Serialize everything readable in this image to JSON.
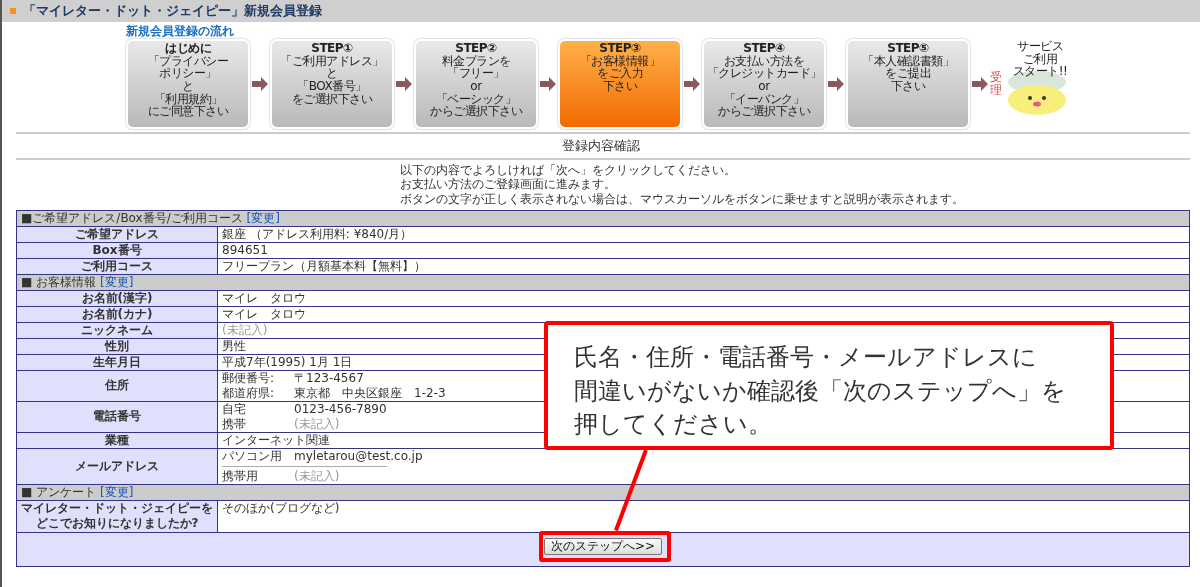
{
  "header": {
    "title": "「マイレター・ドット・ジェイピー」新規会員登録"
  },
  "flow": {
    "title": "新規会員登録の流れ",
    "steps": [
      {
        "heading": "はじめに",
        "lines": [
          "「プライバシー",
          "ポリシー」",
          "と",
          "「利用規約」",
          "にご同意下さい"
        ],
        "selected": false
      },
      {
        "heading": "STEP①",
        "lines": [
          "「ご利用アドレス」",
          "と",
          "「BOX番号」",
          "をご選択下さい"
        ],
        "selected": false
      },
      {
        "heading": "STEP②",
        "lines": [
          "料金プランを",
          "「フリー」",
          "or",
          "「ベーシック」",
          "からご選択下さい"
        ],
        "selected": false
      },
      {
        "heading": "STEP③",
        "lines": [
          "「お客様情報」",
          "をご入力",
          "下さい"
        ],
        "selected": true
      },
      {
        "heading": "STEP④",
        "lines": [
          "お支払い方法を",
          "「クレジットカード」",
          "or",
          "「イーバンク」",
          "からご選択下さい"
        ],
        "selected": false
      },
      {
        "heading": "STEP⑤",
        "lines": [
          "「本人確認書類」",
          "をご提出",
          "下さい"
        ],
        "selected": false
      }
    ],
    "accepted_label": "受理",
    "final_lines": [
      "サービス",
      "ご利用",
      "スタート!!"
    ]
  },
  "page_title": "登録内容確認",
  "intro": [
    "以下の内容でよろしければ「次へ」をクリックしてください。",
    "お支払い方法のご登録画面に進みます。",
    "ボタンの文字が正しく表示されない場合は、マウスカーソルをボタンに乗せますと説明が表示されます。"
  ],
  "sections": [
    {
      "title": "■ご希望アドレス/Box番号/ご利用コース",
      "change_link": "[変更]",
      "rows": [
        {
          "label": "ご希望アドレス",
          "kind": "text",
          "value": "銀座 （アドレス利用料: ¥840/月）",
          "muted": false
        },
        {
          "label": "Box番号",
          "kind": "text",
          "value": "894651",
          "muted": false
        },
        {
          "label": "ご利用コース",
          "kind": "text",
          "value": "フリープラン（月額基本料【無料】）",
          "muted": false
        }
      ]
    },
    {
      "title": "■ お客様情報",
      "change_link": "[変更]",
      "rows": [
        {
          "label": "お名前(漢字)",
          "kind": "text",
          "value": "マイレ　タロウ",
          "muted": false
        },
        {
          "label": "お名前(カナ)",
          "kind": "text",
          "value": "マイレ　タロウ",
          "muted": false
        },
        {
          "label": "ニックネーム",
          "kind": "text",
          "value": "(未記入)",
          "muted": true
        },
        {
          "label": "性別",
          "kind": "text",
          "value": "男性",
          "muted": false
        },
        {
          "label": "生年月日",
          "kind": "text",
          "value": "平成7年(1995) 1月 1日",
          "muted": false
        },
        {
          "label": "住所",
          "kind": "pairs",
          "divided": false,
          "pairs": [
            {
              "key": "郵便番号:",
              "value": "〒123-4567",
              "muted": false
            },
            {
              "key": "都道府県:",
              "value": "東京都　中央区銀座　1-2-3",
              "muted": false
            }
          ]
        },
        {
          "label": "電話番号",
          "kind": "pairs",
          "divided": false,
          "pairs": [
            {
              "key": "自宅",
              "value": "0123-456-7890",
              "muted": false
            },
            {
              "key": "携帯",
              "value": "(未記入)",
              "muted": true
            }
          ]
        },
        {
          "label": "業種",
          "kind": "text",
          "value": "インターネット関連",
          "muted": false
        },
        {
          "label": "メールアドレス",
          "kind": "pairs",
          "divided": true,
          "pairs": [
            {
              "key": "パソコン用",
              "value": "myletarou@test.co.jp",
              "muted": false
            },
            {
              "key": "携帯用",
              "value": "(未記入)",
              "muted": true
            }
          ]
        }
      ]
    },
    {
      "title": "■ アンケート",
      "change_link": "[変更]",
      "rows": [
        {
          "label_lines": [
            "マイレター・ドット・ジェイピーを",
            "どこでお知りになりましたか?"
          ],
          "kind": "tall",
          "value": "そのほか(ブログなど)",
          "muted": false
        }
      ]
    }
  ],
  "next_button": "次のステップへ>>",
  "callout": {
    "lines": [
      "氏名・住所・電話番号・メールアドレスに",
      "間違いがないか確認後「次のステップへ」を",
      "押してください。"
    ]
  }
}
